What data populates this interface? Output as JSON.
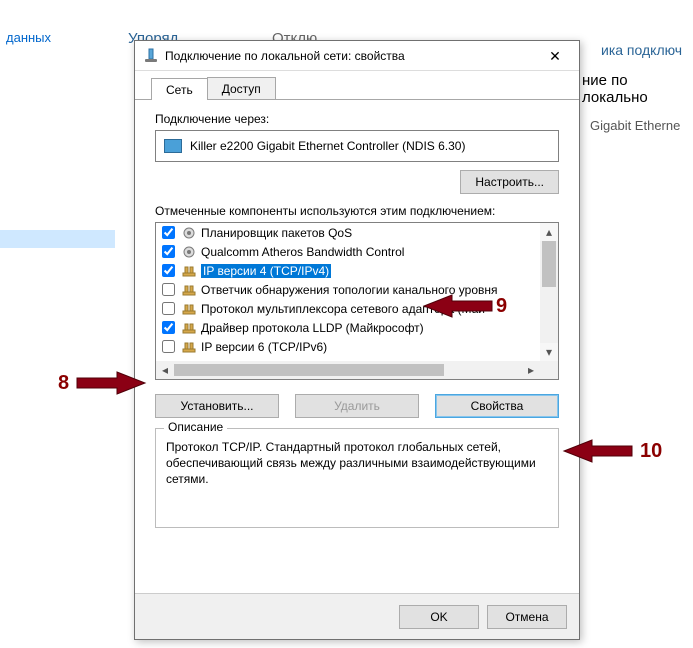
{
  "bg": {
    "sidebar_label": "данных",
    "link_fragment_1": "ика подключ",
    "link_fragment_2": "ние по локально",
    "adapter_fragment": "Gigabit Etherne",
    "toolbar_fragment_left": "Упоряд",
    "toolbar_fragment_mid": "Отклю"
  },
  "dialog": {
    "title": "Подключение по локальной сети: свойства",
    "tabs": {
      "network": "Сеть",
      "sharing": "Доступ"
    },
    "connect_through_label": "Подключение через:",
    "adapter_name": "Killer e2200 Gigabit Ethernet Controller (NDIS 6.30)",
    "configure_btn": "Настроить...",
    "components_label": "Отмеченные компоненты используются этим подключением:",
    "components": [
      {
        "checked": true,
        "icon": "gear",
        "label": "Планировщик пакетов QoS"
      },
      {
        "checked": true,
        "icon": "gear",
        "label": "Qualcomm Atheros Bandwidth Control"
      },
      {
        "checked": true,
        "icon": "net",
        "label": "IP версии 4 (TCP/IPv4)",
        "selected": true
      },
      {
        "checked": false,
        "icon": "net",
        "label": "Ответчик обнаружения топологии канального уровня"
      },
      {
        "checked": false,
        "icon": "net",
        "label": "Протокол мультиплексора сетевого адаптера (Май"
      },
      {
        "checked": true,
        "icon": "net",
        "label": "Драйвер протокола LLDP (Майкрософт)"
      },
      {
        "checked": false,
        "icon": "net",
        "label": "IP версии 6 (TCP/IPv6)"
      }
    ],
    "install_btn": "Установить...",
    "uninstall_btn": "Удалить",
    "properties_btn": "Свойства",
    "description_header": "Описание",
    "description_text": "Протокол TCP/IP. Стандартный протокол глобальных сетей, обеспечивающий связь между различными взаимодействующими сетями.",
    "ok_btn": "OK",
    "cancel_btn": "Отмена"
  },
  "annotations": {
    "eight": "8",
    "nine": "9",
    "ten": "10"
  }
}
